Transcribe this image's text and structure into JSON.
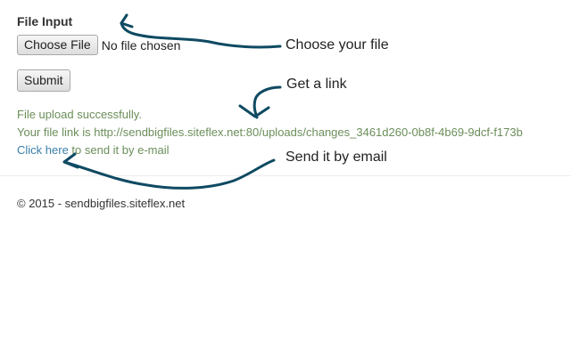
{
  "form": {
    "label": "File Input",
    "choose_button": "Choose File",
    "file_status": "No file chosen",
    "submit_button": "Submit"
  },
  "result": {
    "success_message": "File upload successfully.",
    "link_text": "Your file link is http://sendbigfiles.siteflex.net:80/uploads/changes_3461d260-0b8f-4b69-9dcf-f173b",
    "email_link": "Click here",
    "email_suffix": " to send it by e-mail"
  },
  "footer": {
    "copyright": "© 2015 - sendbigfiles.siteflex.net"
  },
  "annotations": {
    "choose": "Choose your file",
    "link": "Get a link",
    "email": "Send it by email",
    "arrow_color": "#0f4a62"
  },
  "colors": {
    "success_text": "#6b8e5a",
    "link_color": "#3a7fa8"
  }
}
